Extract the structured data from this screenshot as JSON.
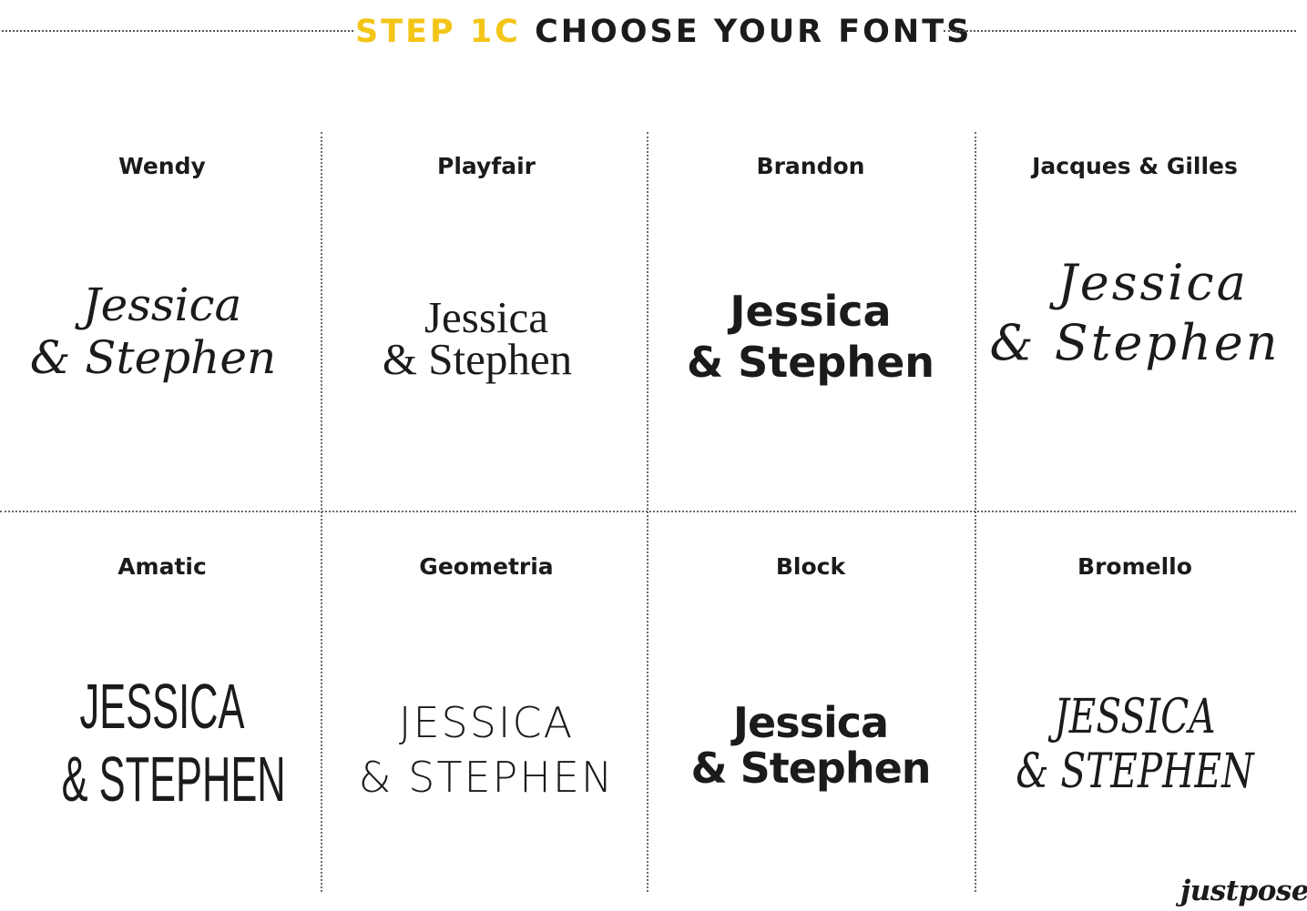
{
  "header": {
    "step": "STEP 1C",
    "title": "CHOOSE YOUR FONTS"
  },
  "fonts": [
    {
      "name": "Wendy",
      "sample_line1": "Jessica",
      "sample_line2": "& Stephen"
    },
    {
      "name": "Playfair",
      "sample_line1": "Jessica",
      "sample_line2": "& Stephen"
    },
    {
      "name": "Brandon",
      "sample_line1": "Jessica",
      "sample_line2": "& Stephen"
    },
    {
      "name": "Jacques & Gilles",
      "sample_line1": "Jessica",
      "sample_line2": "& Stephen"
    },
    {
      "name": "Amatic",
      "sample_line1": "JESSICA",
      "sample_line2": "& STEPHEN"
    },
    {
      "name": "Geometria",
      "sample_line1": "JESSICA",
      "sample_line2": "& STEPHEN"
    },
    {
      "name": "Block",
      "sample_line1": "Jessica",
      "sample_line2": "& Stephen"
    },
    {
      "name": "Bromello",
      "sample_line1": "JESSICA",
      "sample_line2": "& STEPHEN"
    }
  ],
  "logo": "justpose",
  "colors": {
    "accent": "#f3c517",
    "text": "#1c1a1b",
    "background": "#ffffff"
  }
}
